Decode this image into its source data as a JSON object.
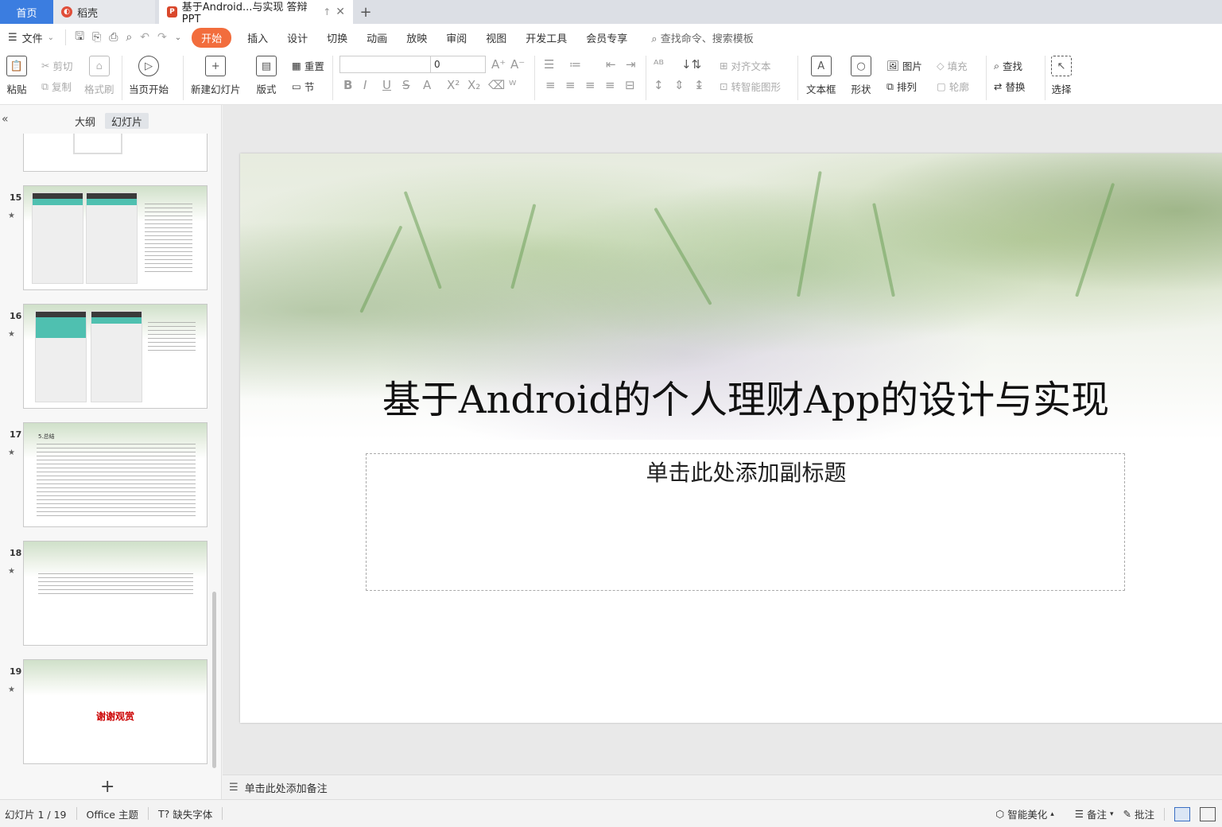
{
  "tabs": {
    "home": "首页",
    "daoke": "稻壳",
    "doc": "基于Android...与实现 答辩PPT",
    "new_tab": "+"
  },
  "menu": {
    "file": "文件",
    "items": [
      "开始",
      "插入",
      "设计",
      "切换",
      "动画",
      "放映",
      "审阅",
      "视图",
      "开发工具",
      "会员专享"
    ],
    "active": "开始",
    "search": "查找命令、搜索模板"
  },
  "ribbon": {
    "paste": "粘贴",
    "cut": "剪切",
    "copy": "复制",
    "format_painter": "格式刷",
    "play_from_current": "当页开始",
    "new_slide": "新建幻灯片",
    "layout": "版式",
    "reset": "重置",
    "section": "节",
    "font_name": "",
    "font_size": "0",
    "align_text": "对齐文本",
    "smart_art": "转智能图形",
    "textbox": "文本框",
    "shape": "形状",
    "picture": "图片",
    "fill": "填充",
    "arrange": "排列",
    "outline": "轮廓",
    "find": "查找",
    "replace": "替换",
    "select": "选择"
  },
  "panel": {
    "outline_tab": "大纲",
    "slides_tab": "幻灯片",
    "thumbs": [
      {
        "num": "15"
      },
      {
        "num": "16"
      },
      {
        "num": "17",
        "heading": "5.总结"
      },
      {
        "num": "18"
      },
      {
        "num": "19",
        "text": "谢谢观赏"
      }
    ]
  },
  "slide": {
    "title": "基于Android的个人理财App的设计与实现",
    "subtitle_placeholder": "单击此处添加副标题"
  },
  "notes_placeholder": "单击此处添加备注",
  "status": {
    "slide_index": "幻灯片 1 / 19",
    "theme": "Office 主题",
    "missing_font": "缺失字体",
    "beautify": "智能美化",
    "notes": "备注",
    "comments": "批注"
  },
  "colors": {
    "accent": "#f26d3d",
    "home_tab": "#3b7de0",
    "thanks_text": "#cc0000"
  }
}
